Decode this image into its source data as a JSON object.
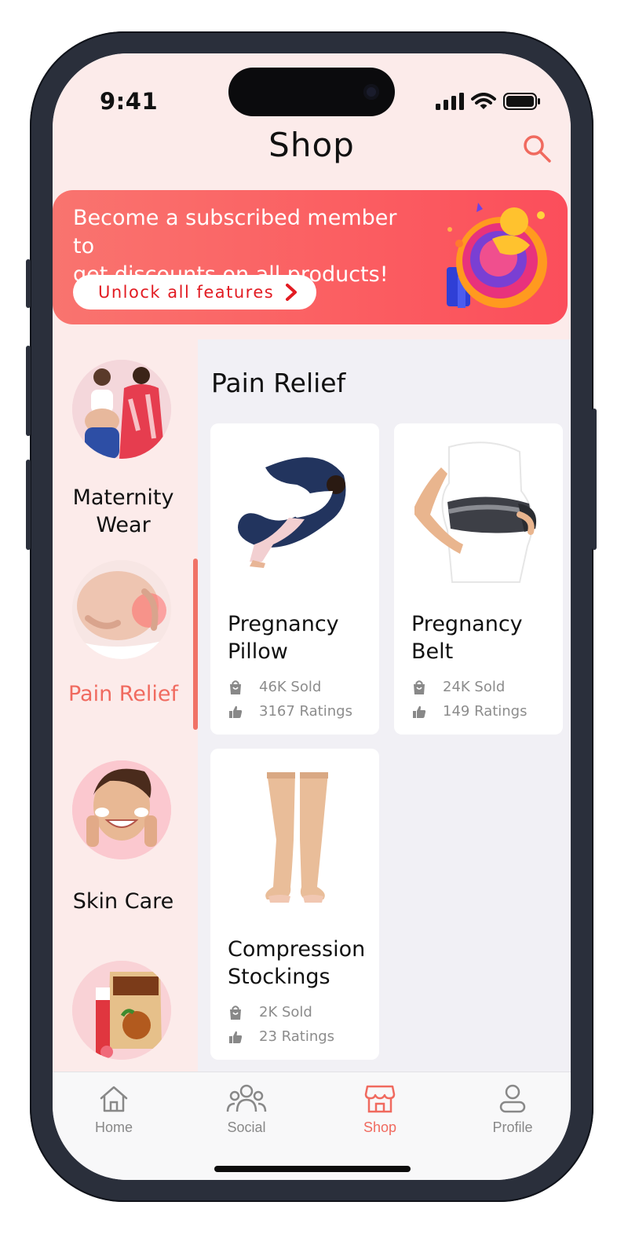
{
  "status": {
    "time": "9:41"
  },
  "header": {
    "title": "Shop"
  },
  "banner": {
    "line1": "Become a subscribed member to",
    "line2": "get discounts on all products!",
    "cta": "Unlock all features"
  },
  "sidebar": {
    "items": [
      {
        "line1": "Maternity",
        "line2": "Wear",
        "active": false
      },
      {
        "line1": "Pain Relief",
        "line2": "",
        "active": true
      },
      {
        "line1": "Skin Care",
        "line2": "",
        "active": false
      },
      {
        "line1": "",
        "line2": "",
        "active": false
      }
    ]
  },
  "section": {
    "title": "Pain Relief"
  },
  "products": [
    {
      "name1": "Pregnancy",
      "name2": "Pillow",
      "sold": "46K Sold",
      "ratings": "3167 Ratings",
      "image_icon": "pregnancy-pillow-image"
    },
    {
      "name1": "Pregnancy",
      "name2": "Belt",
      "sold": "24K Sold",
      "ratings": "149 Ratings",
      "image_icon": "pregnancy-belt-image"
    },
    {
      "name1": "Compression",
      "name2": "Stockings",
      "sold": "2K Sold",
      "ratings": "23 Ratings",
      "image_icon": "compression-stockings-image"
    }
  ],
  "tabbar": {
    "items": [
      {
        "label": "Home",
        "icon": "home-icon",
        "active": false
      },
      {
        "label": "Social",
        "icon": "people-icon",
        "active": false
      },
      {
        "label": "Shop",
        "icon": "store-icon",
        "active": true
      },
      {
        "label": "Profile",
        "icon": "user-icon",
        "active": false
      }
    ]
  },
  "colors": {
    "accent": "#f06a5f",
    "banner": "#fb5f62",
    "cta_text": "#e21b22",
    "bg_pink": "#fcebea"
  }
}
